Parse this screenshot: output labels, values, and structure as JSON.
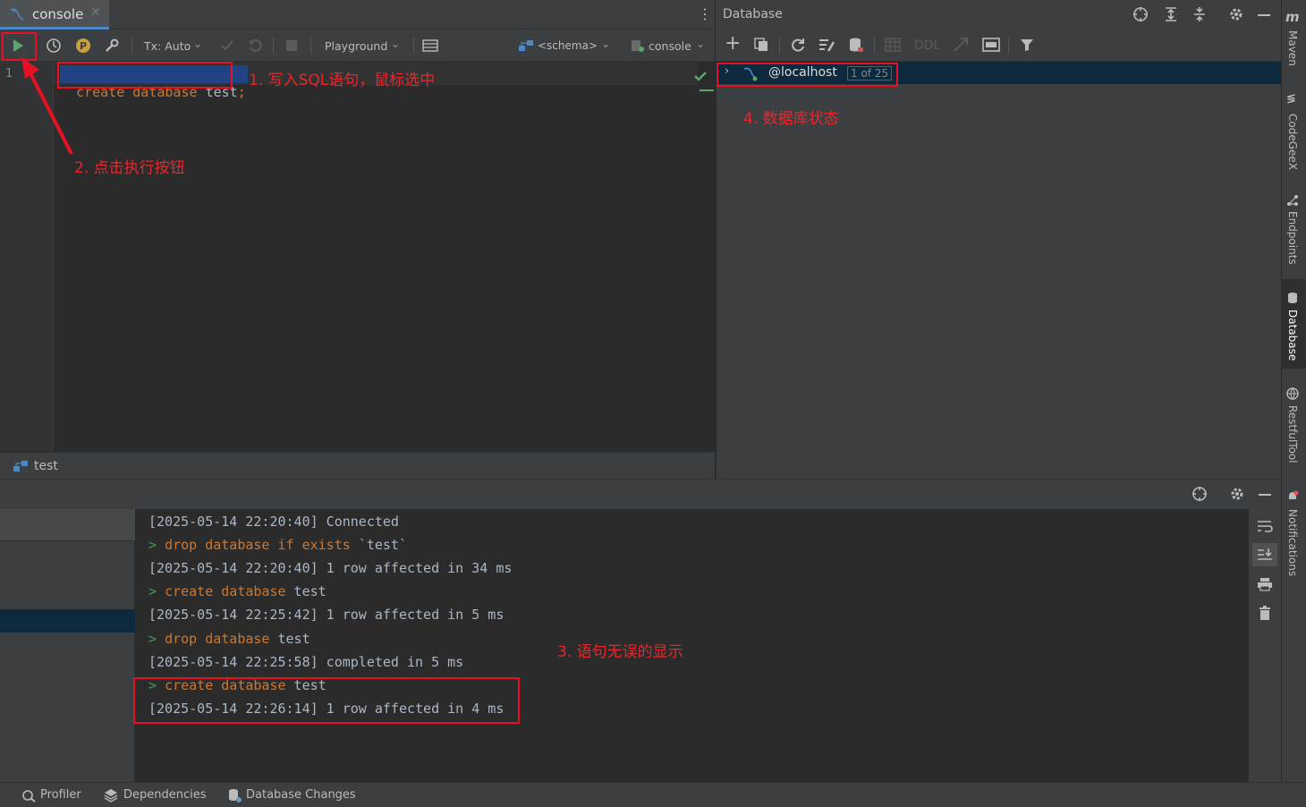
{
  "editor_tab": {
    "label": "console"
  },
  "toolbar": {
    "tx_mode": "Tx: Auto",
    "playground": "Playground",
    "schema": "<schema>",
    "session": "console"
  },
  "editor": {
    "line_number": "1",
    "code_kw1": "create",
    "code_kw2": "database",
    "code_ident": "test",
    "code_semicolon": ";"
  },
  "services_tab": {
    "label": "test"
  },
  "database_panel": {
    "title": "Database",
    "ddl_label": "DDL",
    "connection": "@localhost",
    "schema_count": "1 of 25"
  },
  "right_strip": [
    "Maven",
    "CodeGeeX",
    "Endpoints",
    "Database",
    "RestfulTool",
    "Notifications"
  ],
  "output": {
    "l1": "[2025-05-14 22:20:40] Connected",
    "l2_kw": "drop database if exists",
    "l2_rest": " `test`",
    "l3": "[2025-05-14 22:20:40] 1 row affected in 34 ms",
    "l4_kw": "create database",
    "l4_rest": " test",
    "l5": "[2025-05-14 22:25:42] 1 row affected in 5 ms",
    "l6_kw": "drop database",
    "l6_rest": " test",
    "l7": "[2025-05-14 22:25:58] completed in 5 ms",
    "l8_kw": "create database",
    "l8_rest": " test",
    "l9": "[2025-05-14 22:26:14] 1 row affected in 4 ms",
    "prompt": ">"
  },
  "annotations": {
    "a1": "1. 写入SQL语句，鼠标选中",
    "a2": "2. 点击执行按钮",
    "a3": "3. 语句无误的显示",
    "a4": "4. 数据库状态"
  },
  "statusbar": {
    "profiler": "Profiler",
    "dependencies": "Dependencies",
    "db_changes": "Database Changes"
  },
  "colors": {
    "annotation": "#e81123",
    "keyword": "#cc7832",
    "prompt": "#499c54",
    "accent": "#4a88c7"
  }
}
